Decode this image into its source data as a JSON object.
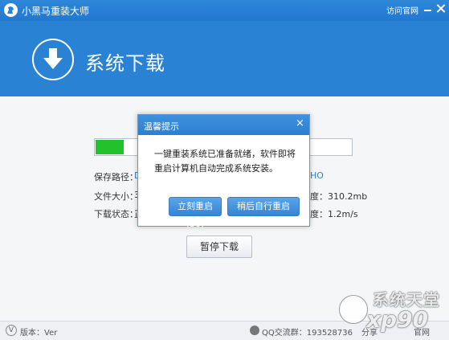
{
  "app": {
    "title": "小黑马重装大师",
    "site_link": "访问官网"
  },
  "header": {
    "title": "系统下载"
  },
  "progress": {
    "fraction": 0.11
  },
  "info": {
    "path_label": "保存路径：",
    "path_value_start": "D",
    "path_value_end": "HO",
    "size_label": "文件大小：",
    "size_value_start": "3",
    "size_right": "度：310.2mb",
    "status_label": "下载状态：",
    "status_value_start": "正",
    "status_right": "度：1.2m/s"
  },
  "buttons": {
    "pause": "暂停下载"
  },
  "dialog": {
    "title": "温馨提示",
    "close": "×",
    "message": "一键重装系统已准备就绪，软件即将重启计算机自动完成系统安装。",
    "restart_now": "立刻重启(30)",
    "restart_later": "稍后自行重启"
  },
  "statusbar": {
    "version": "版本：Ver",
    "qq_group": "QQ交流群：193528736",
    "share": "分享",
    "home": "官网"
  },
  "watermark": {
    "line1": "系统天堂",
    "line2": "xp90"
  },
  "colors": {
    "brand_blue": "#2a82d5",
    "progress_green": "#22c22a"
  }
}
